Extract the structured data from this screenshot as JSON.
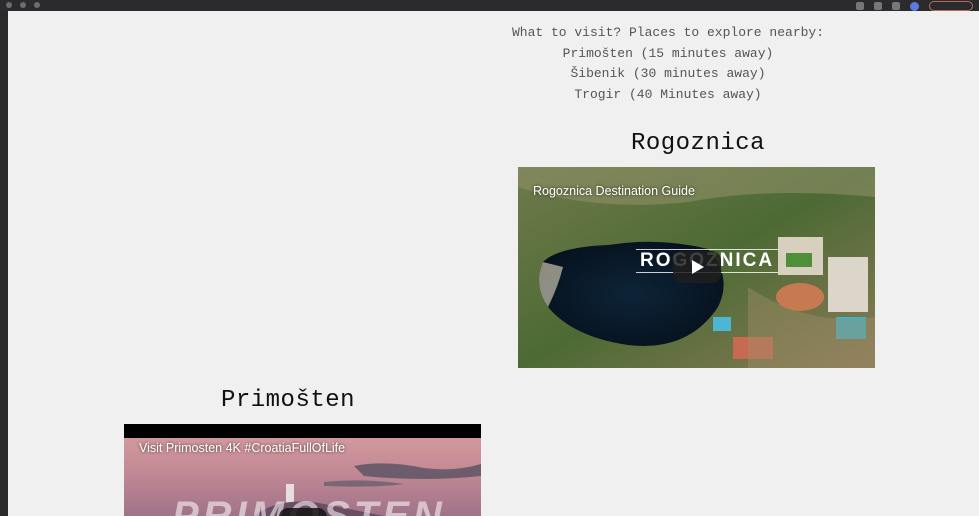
{
  "intro": {
    "line1": "What to visit? Places to explore nearby:",
    "line2": "Primošten (15 minutes away)",
    "line3": "Šibenik (30 minutes away)",
    "line4": "Trogir (40 Minutes away)"
  },
  "sections": [
    {
      "title": "Rogoznica",
      "video_title": "Rogoznica Destination Guide",
      "overlay_word": "ROGOZNICA"
    },
    {
      "title": "Primošten",
      "video_title": "Visit Primosten 4K #CroatiaFullOfLife",
      "overlay_word": "PRIMOSTEN"
    }
  ],
  "icons": {
    "play": "play-icon"
  },
  "colors": {
    "page_bg": "#f0f0f0",
    "text": "#555555",
    "heading": "#111111"
  }
}
